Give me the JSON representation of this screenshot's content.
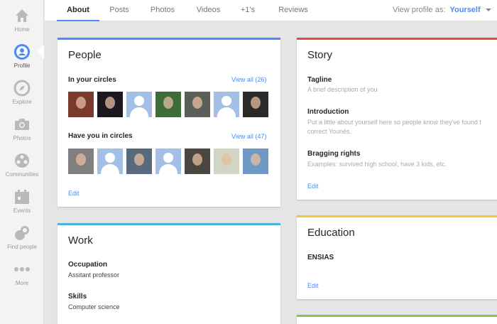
{
  "sidebar": {
    "items": [
      {
        "label": "Home",
        "icon": "home-icon"
      },
      {
        "label": "Profile",
        "icon": "profile-icon"
      },
      {
        "label": "Explore",
        "icon": "compass-icon"
      },
      {
        "label": "Photos",
        "icon": "camera-icon"
      },
      {
        "label": "Communities",
        "icon": "communities-icon"
      },
      {
        "label": "Events",
        "icon": "calendar-icon"
      },
      {
        "label": "Find people",
        "icon": "find-people-icon"
      },
      {
        "label": "More",
        "icon": "more-dots-icon"
      }
    ]
  },
  "tabs": [
    "About",
    "Posts",
    "Photos",
    "Videos",
    "+1's",
    "Reviews"
  ],
  "view_profile": {
    "label": "View profile as:",
    "value": "Yourself"
  },
  "people": {
    "title": "People",
    "in_circles": {
      "label": "In your circles",
      "view_all": "View all (26)"
    },
    "have_you": {
      "label": "Have you in circles",
      "view_all": "View all (47)"
    },
    "edit": "Edit"
  },
  "story": {
    "title": "Story",
    "tagline": {
      "label": "Tagline",
      "text": "A brief description of you"
    },
    "intro": {
      "label": "Introduction",
      "line1": "Put a little about yourself here so people know they've found t",
      "line2": "correct Younès."
    },
    "bragging": {
      "label": "Bragging rights",
      "text": "Examples: survived high school, have 3 kids, etc."
    },
    "edit": "Edit"
  },
  "work": {
    "title": "Work",
    "occupation": {
      "label": "Occupation",
      "value": "Assitant professor"
    },
    "skills": {
      "label": "Skills",
      "value": "Computer science"
    }
  },
  "education": {
    "title": "Education",
    "school": "ENSIAS",
    "edit": "Edit"
  },
  "colors": {
    "people_bar": "#4a8af4",
    "story_bar": "#dd4b39",
    "work_bar": "#4ab3d6",
    "education_bar": "#f4c63d",
    "next_bar": "#8bc34a",
    "accent": "#4a8af4"
  }
}
